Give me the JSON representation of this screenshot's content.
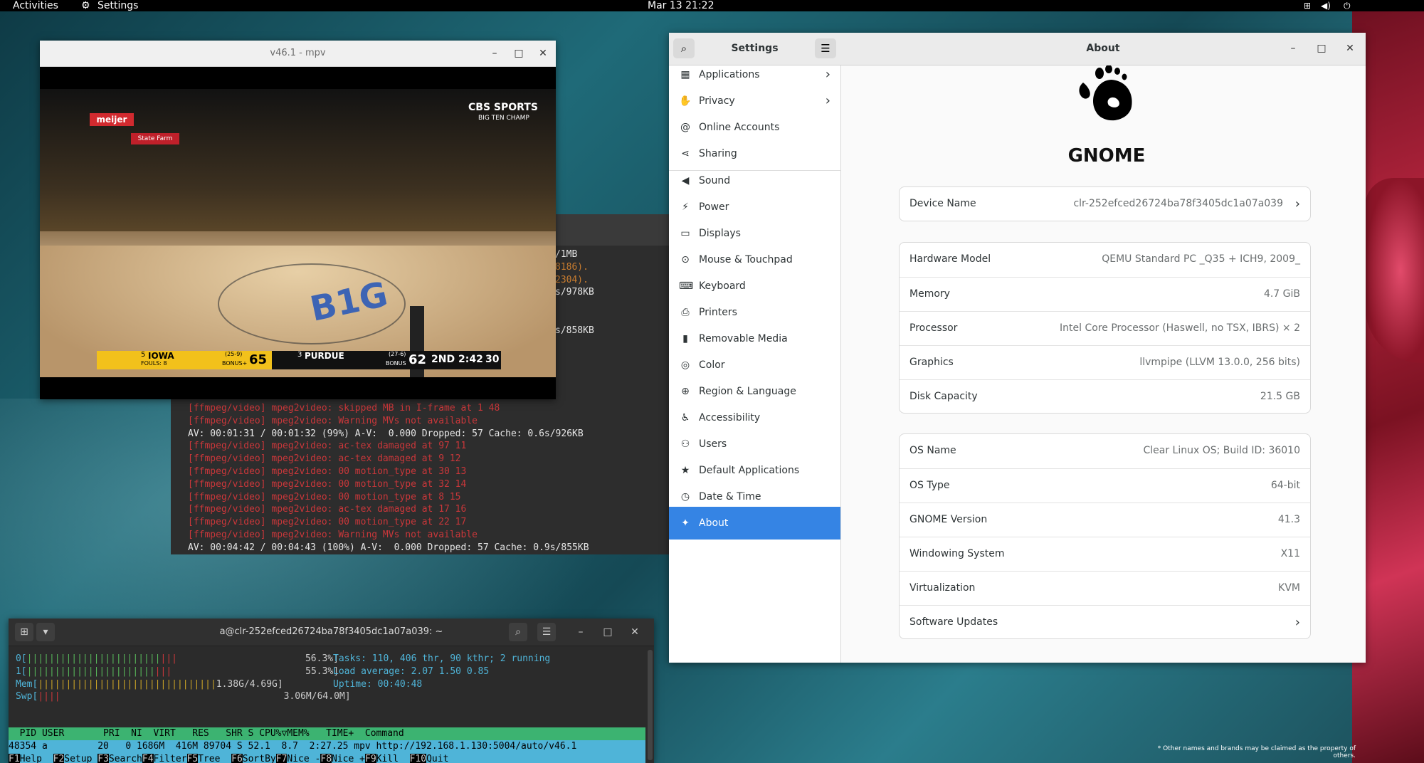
{
  "topbar": {
    "activities": "Activities",
    "app_name": "Settings",
    "clock": "Mar 13 21:22"
  },
  "bg_terminal": {
    "title": "a@clr-252efced26724ba78f3405dc1a07a039: ~",
    "right_lines": [
      "/1MB",
      "8186).",
      "2304).",
      "s/978KB",
      "s/858KB"
    ],
    "lines": [
      {
        "text": "[ffmpeg/video] mpeg2video: skipped MB in I-frame at 1 48",
        "kind": "err"
      },
      {
        "text": "[ffmpeg/video] mpeg2video: Warning MVs not available",
        "kind": "err"
      },
      {
        "text": "AV: 00:01:31 / 00:01:32 (99%) A-V:  0.000 Dropped: 57 Cache: 0.6s/926KB",
        "kind": "ok"
      },
      {
        "text": "[ffmpeg/video] mpeg2video: ac-tex damaged at 97 11",
        "kind": "err"
      },
      {
        "text": "[ffmpeg/video] mpeg2video: ac-tex damaged at 9 12",
        "kind": "err"
      },
      {
        "text": "[ffmpeg/video] mpeg2video: 00 motion_type at 30 13",
        "kind": "err"
      },
      {
        "text": "[ffmpeg/video] mpeg2video: 00 motion_type at 32 14",
        "kind": "err"
      },
      {
        "text": "[ffmpeg/video] mpeg2video: 00 motion_type at 8 15",
        "kind": "err"
      },
      {
        "text": "[ffmpeg/video] mpeg2video: ac-tex damaged at 17 16",
        "kind": "err"
      },
      {
        "text": "[ffmpeg/video] mpeg2video: 00 motion_type at 22 17",
        "kind": "err"
      },
      {
        "text": "[ffmpeg/video] mpeg2video: Warning MVs not available",
        "kind": "err"
      },
      {
        "text": "AV: 00:04:42 / 00:04:43 (100%) A-V:  0.000 Dropped: 57 Cache: 0.9s/855KB",
        "kind": "ok"
      }
    ]
  },
  "mpv": {
    "title": "v46.1 - mpv",
    "scoreboard": {
      "team1_seed": "5",
      "team1": "IOWA",
      "team1_record": "(25-9)",
      "team1_fouls": "FOULS: 8",
      "team1_bonus": "BONUS+",
      "team1_score": "65",
      "team2_seed": "3",
      "team2": "PURDUE",
      "team2_record": "(27-6)",
      "team2_bonus": "BONUS",
      "team2_score": "62",
      "period": "2ND",
      "clock": "2:42",
      "shot_clock": "30"
    },
    "network_logo": "CBS SPORTS",
    "network_sub": "BIG TEN CHAMP",
    "ad_meijer": "meijer",
    "ad_statefarm": "State Farm"
  },
  "settings": {
    "window_title": "Settings",
    "page_title": "About",
    "sidebar": [
      {
        "label": "Applications",
        "icon": "grid",
        "chevron": true
      },
      {
        "label": "Privacy",
        "icon": "hand",
        "chevron": true
      },
      {
        "label": "Online Accounts",
        "icon": "at"
      },
      {
        "label": "Sharing",
        "icon": "share"
      },
      {
        "label": "Sound",
        "icon": "speaker"
      },
      {
        "label": "Power",
        "icon": "power"
      },
      {
        "label": "Displays",
        "icon": "display"
      },
      {
        "label": "Mouse & Touchpad",
        "icon": "mouse"
      },
      {
        "label": "Keyboard",
        "icon": "keyboard"
      },
      {
        "label": "Printers",
        "icon": "printer"
      },
      {
        "label": "Removable Media",
        "icon": "usb"
      },
      {
        "label": "Color",
        "icon": "color"
      },
      {
        "label": "Region & Language",
        "icon": "globe"
      },
      {
        "label": "Accessibility",
        "icon": "accessibility"
      },
      {
        "label": "Users",
        "icon": "users"
      },
      {
        "label": "Default Applications",
        "icon": "star"
      },
      {
        "label": "Date & Time",
        "icon": "clock"
      },
      {
        "label": "About",
        "icon": "sparkle",
        "selected": true
      }
    ],
    "logo_text": "GNOME",
    "device_name_label": "Device Name",
    "device_name_value": "clr-252efced26724ba78f3405dc1a07a039",
    "hardware": [
      {
        "k": "Hardware Model",
        "v": "QEMU Standard PC _Q35 + ICH9, 2009_"
      },
      {
        "k": "Memory",
        "v": "4.7 GiB"
      },
      {
        "k": "Processor",
        "v": "Intel Core Processor (Haswell, no TSX, IBRS) × 2"
      },
      {
        "k": "Graphics",
        "v": "llvmpipe (LLVM 13.0.0, 256 bits)"
      },
      {
        "k": "Disk Capacity",
        "v": "21.5 GB"
      }
    ],
    "os": [
      {
        "k": "OS Name",
        "v": "Clear Linux OS; Build ID: 36010"
      },
      {
        "k": "OS Type",
        "v": "64-bit"
      },
      {
        "k": "GNOME Version",
        "v": "41.3"
      },
      {
        "k": "Windowing System",
        "v": "X11"
      },
      {
        "k": "Virtualization",
        "v": "KVM"
      },
      {
        "k": "Software Updates",
        "v": "",
        "chevron": true
      }
    ],
    "footnote": "* Other names and brands may be claimed as the property of others."
  },
  "htop": {
    "title": "a@clr-252efced26724ba78f3405dc1a07a039: ~",
    "cpu0_label": "0[",
    "cpu0_bar": "||||||||||||||||||||||||",
    "cpu0_pct": "56.3%]",
    "cpu1_label": "1[",
    "cpu1_bar": "|||||||||||||||||||||||",
    "cpu1_pct": "55.3%]",
    "mem_label": "Mem[",
    "mem_bar": "||||||||||||||||||||||||||||||||",
    "mem_val": "1.38G/4.69G]",
    "swp_label": "Swp[",
    "swp_bar": "||||",
    "swp_val": "3.06M/64.0M]",
    "tasks": "Tasks: 110, 406 thr, 90 kthr; 2 running",
    "load": "Load average: 2.07 1.50 0.85",
    "uptime": "Uptime: 00:40:48",
    "header": "  PID USER       PRI  NI  VIRT   RES   SHR S CPU%▽MEM%   TIME+  Command",
    "proc_row": "48354 a         20   0 1686M  416M 89704 S 52.1  8.7  2:27.25 mpv http://192.168.1.130:5004/auto/v46.1",
    "fkeys": [
      {
        "k": "F1",
        "l": "Help  "
      },
      {
        "k": "F2",
        "l": "Setup "
      },
      {
        "k": "F3",
        "l": "Search"
      },
      {
        "k": "F4",
        "l": "Filter"
      },
      {
        "k": "F5",
        "l": "Tree  "
      },
      {
        "k": "F6",
        "l": "SortBy"
      },
      {
        "k": "F7",
        "l": "Nice -"
      },
      {
        "k": "F8",
        "l": "Nice +"
      },
      {
        "k": "F9",
        "l": "Kill  "
      },
      {
        "k": "F10",
        "l": "Quit"
      }
    ]
  }
}
